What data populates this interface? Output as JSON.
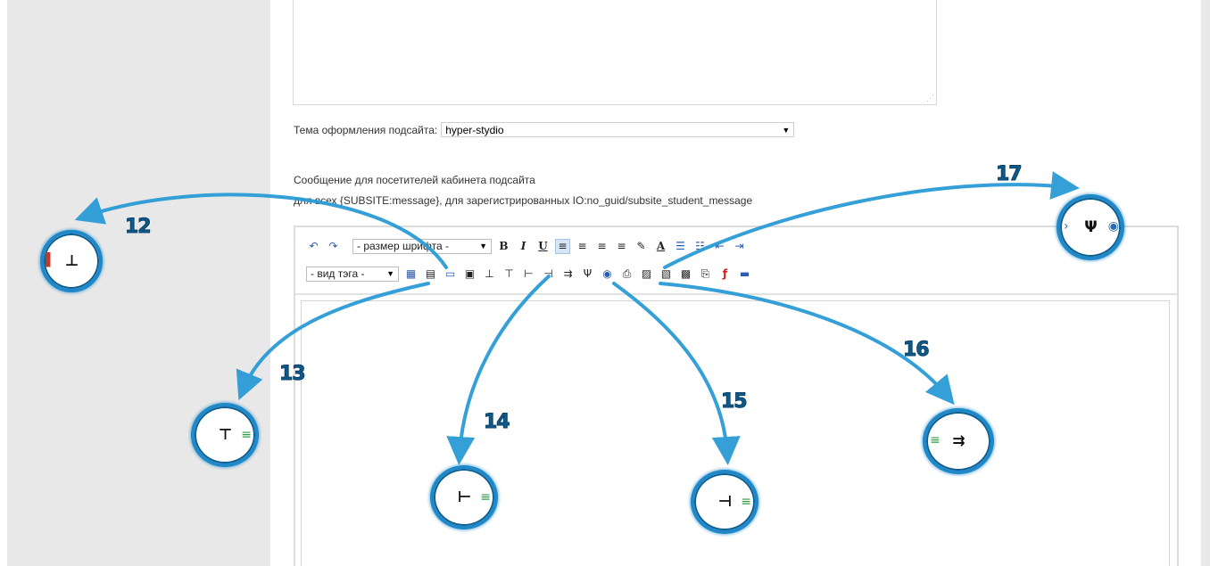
{
  "theme": {
    "label": "Тема оформления подсайта:",
    "selected": "hyper-stydio"
  },
  "message": {
    "title": "Сообщение для посетителей кабинета подсайта",
    "subtitle": "для всех {SUBSITE:message}, для зарегистрированных IO:no_guid/subsite_student_message"
  },
  "toolbar": {
    "font_size_select": "- размер шрифта -",
    "tag_select": "- вид тэга -",
    "row1": [
      {
        "name": "undo-icon",
        "glyph": "↶"
      },
      {
        "name": "redo-icon",
        "glyph": "↷"
      },
      {
        "name": "bold-icon",
        "glyph": "B"
      },
      {
        "name": "italic-icon",
        "glyph": "I"
      },
      {
        "name": "underline-icon",
        "glyph": "U"
      },
      {
        "name": "align-left-icon",
        "glyph": "≡"
      },
      {
        "name": "align-center-icon",
        "glyph": "≡"
      },
      {
        "name": "align-right-icon",
        "glyph": "≡"
      },
      {
        "name": "align-justify-icon",
        "glyph": "≡"
      },
      {
        "name": "highlight-color-icon",
        "glyph": "✎"
      },
      {
        "name": "text-color-icon",
        "glyph": "A"
      },
      {
        "name": "bullet-list-icon",
        "glyph": "☰"
      },
      {
        "name": "numbered-list-icon",
        "glyph": "☷"
      },
      {
        "name": "outdent-icon",
        "glyph": "⇤"
      },
      {
        "name": "indent-icon",
        "glyph": "⇥"
      }
    ],
    "row2": [
      {
        "name": "table-icon",
        "glyph": "▦"
      },
      {
        "name": "table-edit-icon",
        "glyph": "▤"
      },
      {
        "name": "table-properties-icon",
        "glyph": "▭"
      },
      {
        "name": "cell-properties-icon",
        "glyph": "▣"
      },
      {
        "name": "insert-row-above-icon",
        "glyph": "⊥"
      },
      {
        "name": "insert-row-below-icon",
        "glyph": "⊤"
      },
      {
        "name": "insert-column-before-icon",
        "glyph": "⊢"
      },
      {
        "name": "insert-column-after-icon",
        "glyph": "⊣"
      },
      {
        "name": "delete-column-icon",
        "glyph": "⇉"
      },
      {
        "name": "delete-row-icon",
        "glyph": "Ψ"
      },
      {
        "name": "link-icon",
        "glyph": "◉"
      },
      {
        "name": "print-icon",
        "glyph": "⎙"
      },
      {
        "name": "image-icon",
        "glyph": "▨"
      },
      {
        "name": "image-gallery-icon",
        "glyph": "▧"
      },
      {
        "name": "insert-media-icon",
        "glyph": "▩"
      },
      {
        "name": "attachment-icon",
        "glyph": "⎘"
      },
      {
        "name": "flash-icon",
        "glyph": "ƒ"
      },
      {
        "name": "save-icon",
        "glyph": "▬"
      }
    ]
  },
  "callouts": [
    {
      "number": "12",
      "name": "insert-row-above-icon",
      "glyph": "⊥"
    },
    {
      "number": "13",
      "name": "insert-row-below-icon",
      "glyph": "⊤"
    },
    {
      "number": "14",
      "name": "insert-column-before-icon",
      "glyph": "⊢"
    },
    {
      "number": "15",
      "name": "insert-column-after-icon",
      "glyph": "⊣"
    },
    {
      "number": "16",
      "name": "delete-column-icon",
      "glyph": "⇉"
    },
    {
      "number": "17",
      "name": "delete-row-icon",
      "glyph": "Ψ"
    }
  ],
  "colors": {
    "callout_border": "#1e88c8",
    "arrow": "#2b9bd6",
    "number": "#0f5a8a",
    "sidebar": "#e8e8e8"
  }
}
